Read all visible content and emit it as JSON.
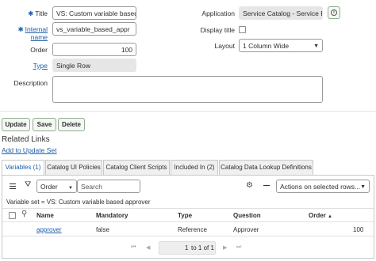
{
  "form": {
    "title_label": "Title",
    "title_value": "VS: Custom variable based ap",
    "internal_name_label_1": "Internal",
    "internal_name_label_2": "name",
    "internal_name_value": "vs_variable_based_appr",
    "order_label": "Order",
    "order_value": "100",
    "type_label": "Type",
    "type_value": "Single Row",
    "description_label": "Description",
    "description_value": "",
    "application_label": "Application",
    "application_value": "Service Catalog - Service Fulf",
    "display_title_label": "Display title",
    "display_title_checked": false,
    "layout_label": "Layout",
    "layout_value": "1 Column Wide"
  },
  "buttons": {
    "update": "Update",
    "save": "Save",
    "delete": "Delete"
  },
  "related_links": {
    "heading": "Related Links",
    "add_to_update_set": "Add to Update Set"
  },
  "tabs": [
    {
      "label": "Variables (1)",
      "active": true
    },
    {
      "label": "Catalog UI Policies",
      "active": false
    },
    {
      "label": "Catalog Client Scripts",
      "active": false
    },
    {
      "label": "Included In (2)",
      "active": false
    },
    {
      "label": "Catalog Data Lookup Definitions",
      "active": false
    }
  ],
  "list_toolbar": {
    "search_field": "Order",
    "search_placeholder": "Search",
    "actions_select": "Actions on selected rows..."
  },
  "breadcrumb": "Variable set = VS: Custom variable based approver",
  "table": {
    "columns": [
      "Name",
      "Mandatory",
      "Type",
      "Question",
      "Order"
    ],
    "sort_indicator": "▲",
    "rows": [
      {
        "name": "approver",
        "mandatory": "false",
        "type": "Reference",
        "question": "Approver",
        "order": "100"
      }
    ]
  },
  "pagination": {
    "current": "1",
    "text": "to 1 of 1"
  },
  "colors": {
    "link": "#1f5ea8",
    "button_border": "#8cae8c",
    "readonly_bg": "#e6e6e6"
  }
}
